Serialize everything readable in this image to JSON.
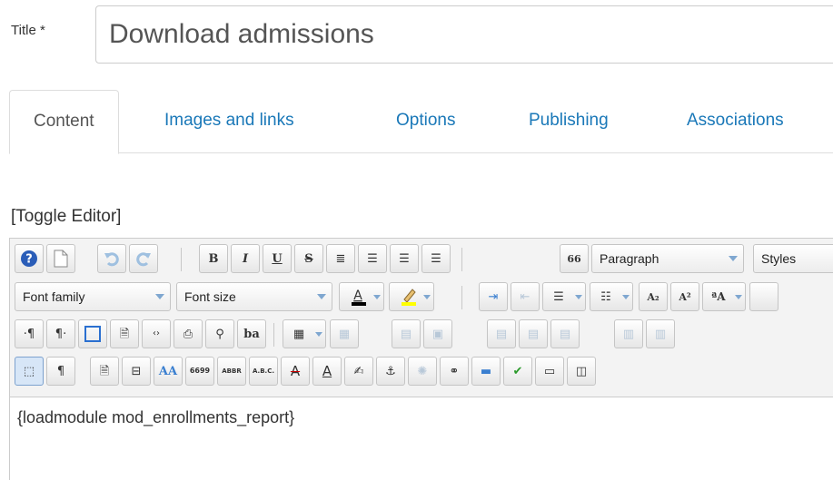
{
  "title": {
    "label": "Title *",
    "value": "Download admissions"
  },
  "tabs": [
    {
      "label": "Content"
    },
    {
      "label": "Images and links"
    },
    {
      "label": "Options"
    },
    {
      "label": "Publishing"
    },
    {
      "label": "Associations"
    }
  ],
  "toggle_editor": "[Toggle Editor]",
  "toolbar": {
    "format_select": "Paragraph",
    "styles_select": "Styles",
    "font_family_select": "Font family",
    "font_size_select": "Font size",
    "buttons": {
      "bold": "B",
      "italic": "I",
      "underline": "U",
      "strikethrough": "S",
      "blockquote": "66",
      "paragraph": "¶",
      "subscript": "A₂",
      "superscript": "A²",
      "abbr": "ABBR",
      "acronym": "A.B.C.",
      "citation": "6699",
      "baseline": "ba"
    }
  },
  "colors": {
    "link": "#1a78b8",
    "font_color": "#000000",
    "highlight": "#ffff00",
    "help": "#2a5db8"
  },
  "content": "{loadmodule mod_enrollments_report}"
}
